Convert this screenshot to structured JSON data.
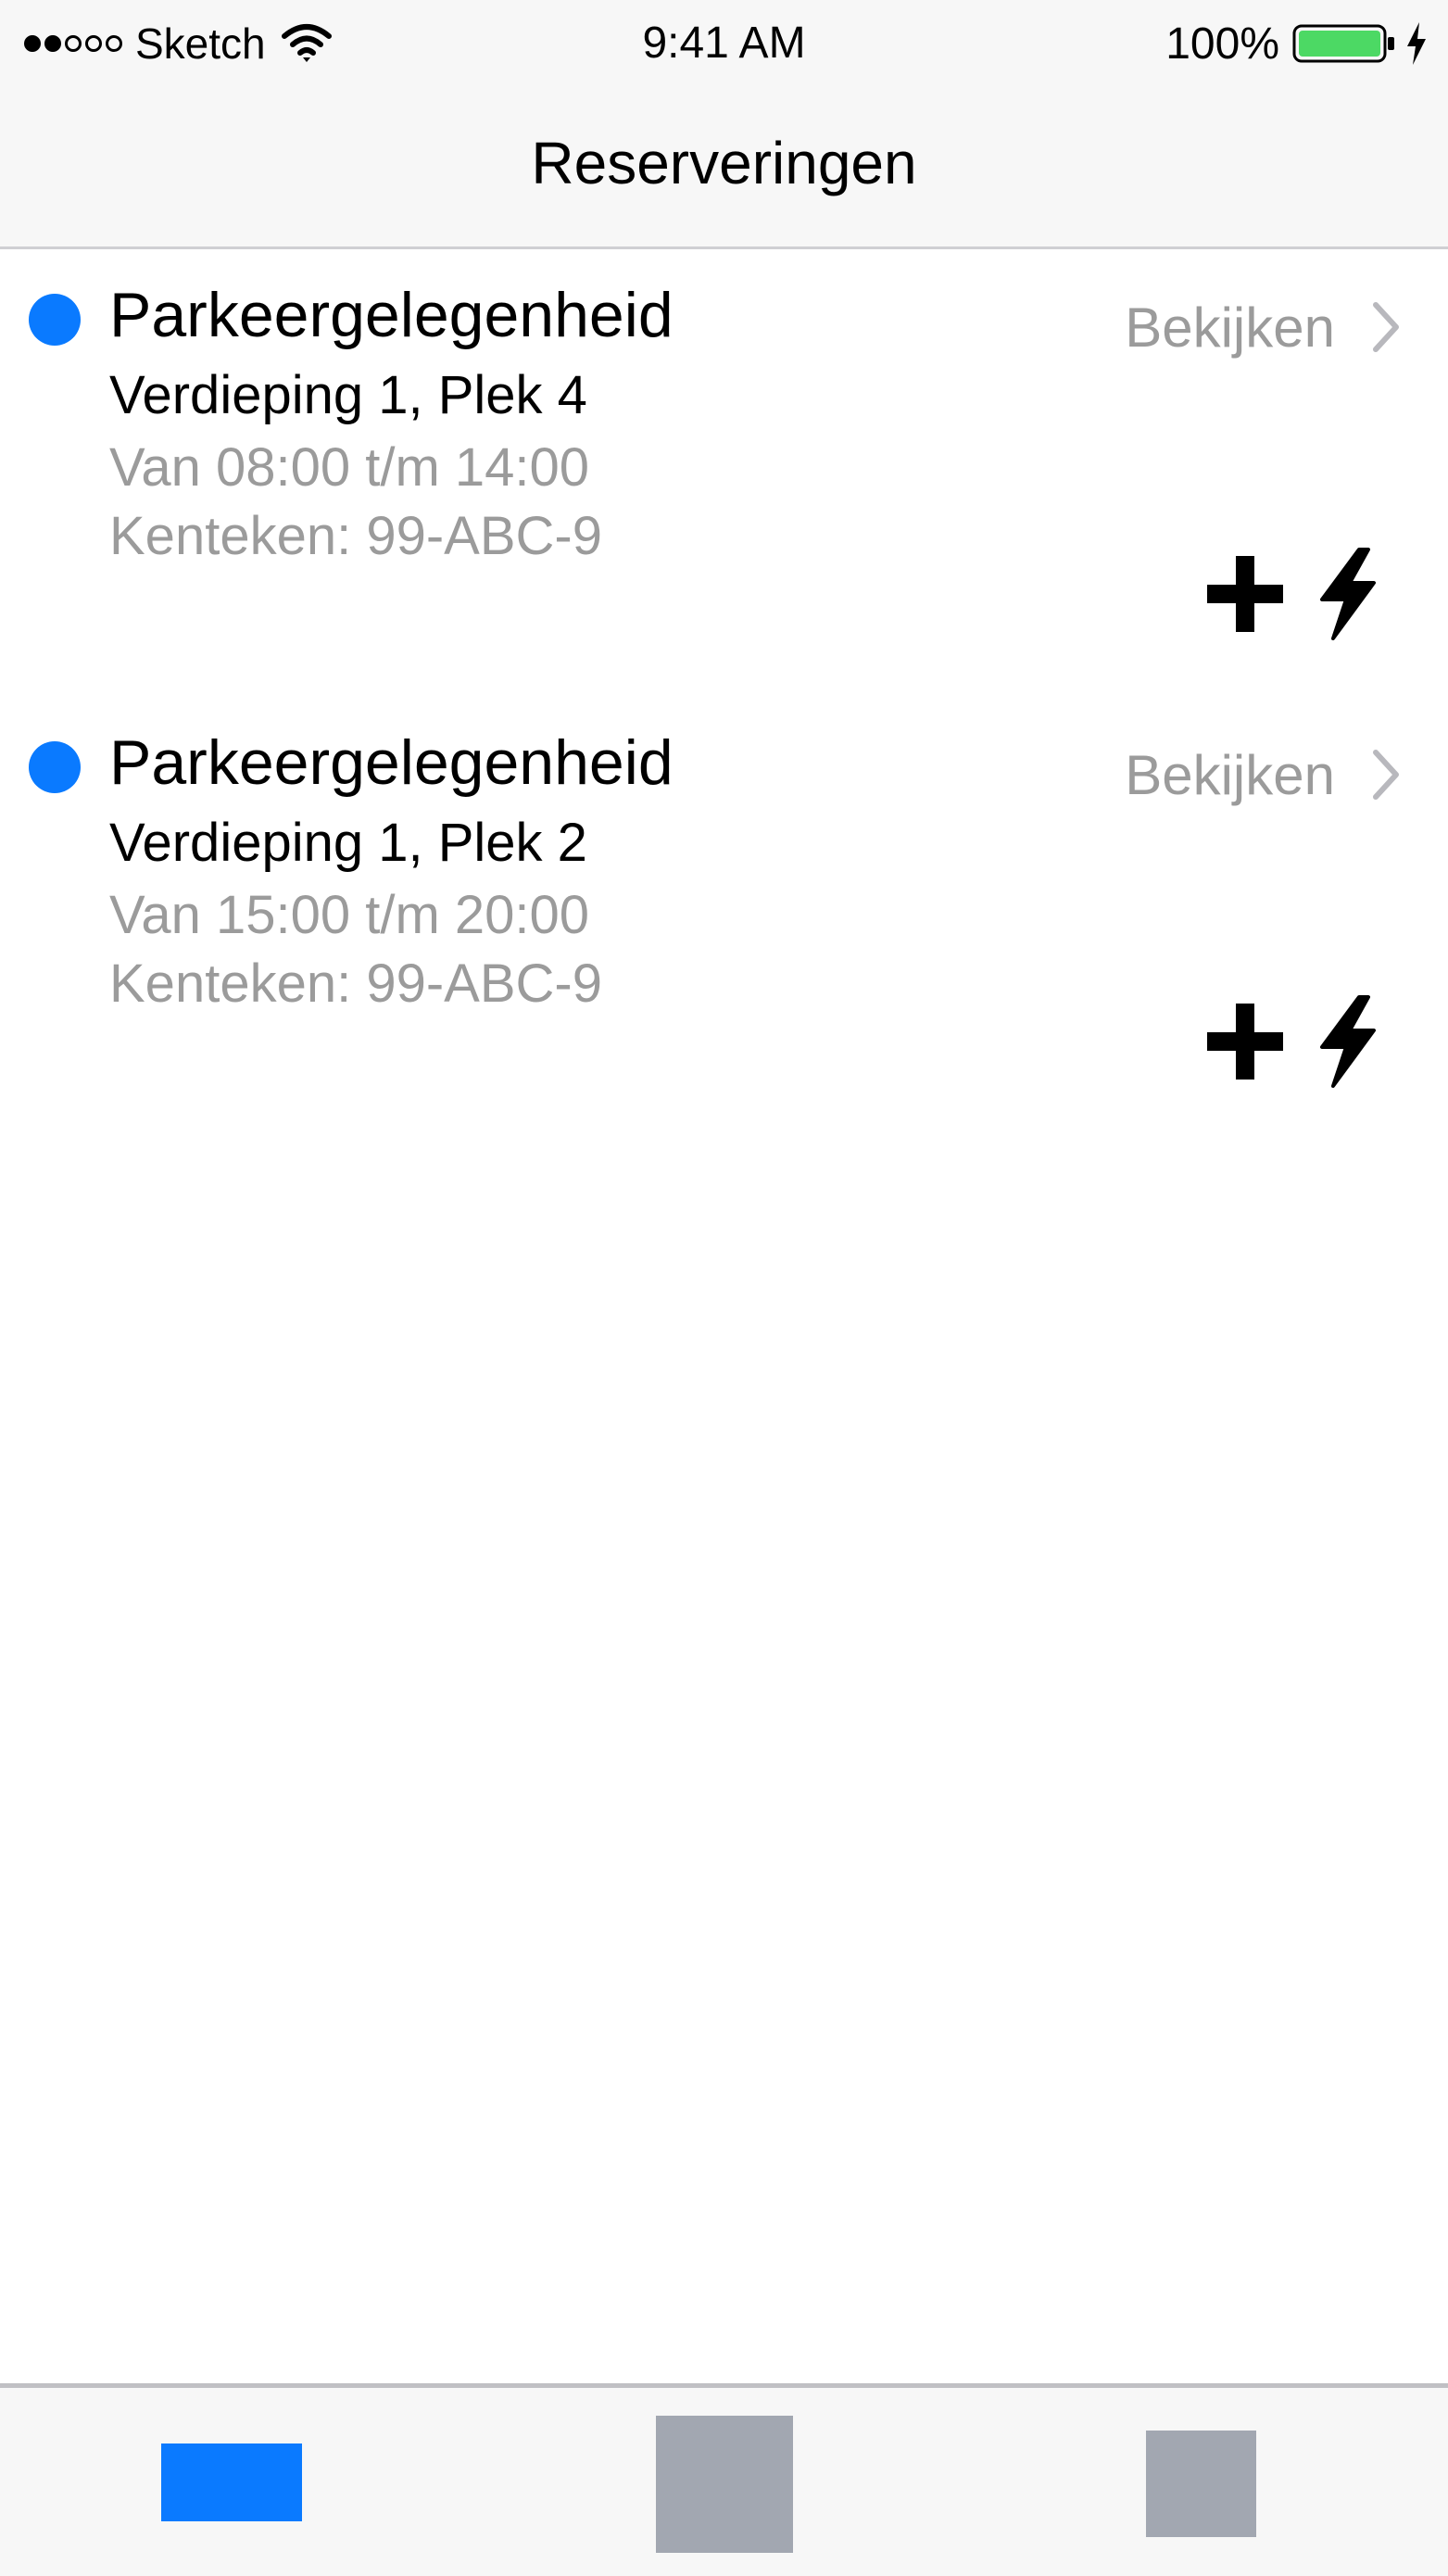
{
  "status_bar": {
    "carrier": "Sketch",
    "time": "9:41 AM",
    "battery": "100%",
    "signal_bars_filled": 2,
    "signal_bars_total": 5,
    "battery_color": "#4cd964"
  },
  "nav": {
    "title": "Reserveringen"
  },
  "colors": {
    "accent": "#0a7aff",
    "secondary_text": "#9b9b9b",
    "tab_inactive": "#a2a7b1"
  },
  "reservations": [
    {
      "title": "Parkeergelegenheid",
      "location": "Verdieping 1, Plek 4",
      "time": "Van 08:00 t/m 14:00",
      "plate": "Kenteken: 99-ABC-9",
      "link_label": "Bekijken",
      "icons": [
        "plus-icon",
        "bolt-icon"
      ]
    },
    {
      "title": "Parkeergelegenheid",
      "location": "Verdieping 1, Plek 2",
      "time": "Van 15:00 t/m 20:00",
      "plate": "Kenteken: 99-ABC-9",
      "link_label": "Bekijken",
      "icons": [
        "plus-icon",
        "bolt-icon"
      ]
    }
  ],
  "tab_bar": {
    "active_index": 0
  }
}
